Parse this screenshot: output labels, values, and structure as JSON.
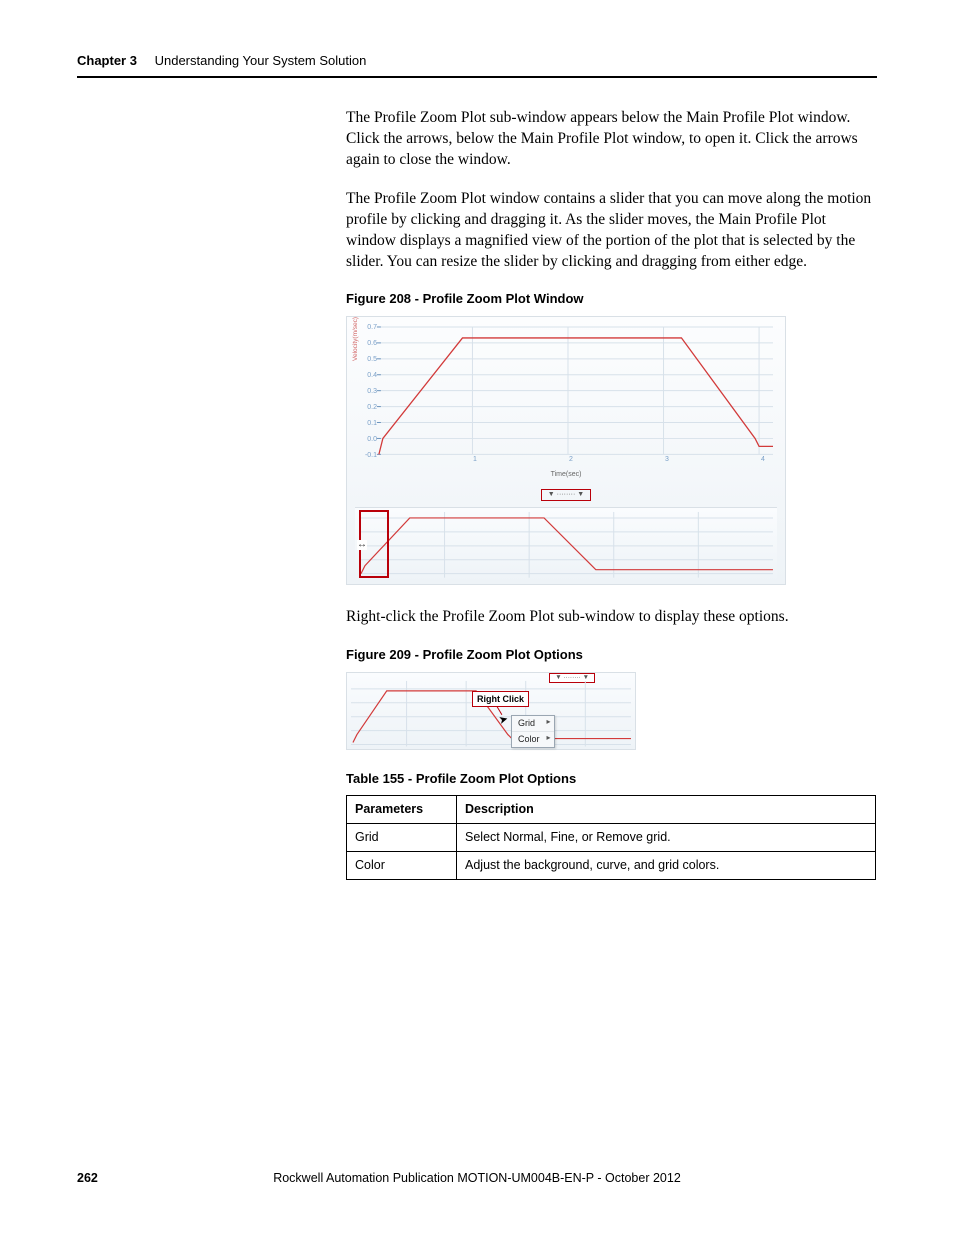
{
  "header": {
    "chapter": "Chapter 3",
    "title": "Understanding Your System Solution"
  },
  "paragraphs": {
    "p1": "The Profile Zoom Plot sub-window appears below the Main Profile Plot window. Click the arrows, below the Main Profile Plot window, to open it. Click the arrows again to close the window.",
    "p2": "The Profile Zoom Plot window contains a slider that you can move along the motion profile by clicking and dragging it. As the slider moves, the Main Profile Plot window displays a magnified view of the portion of the plot that is selected by the slider. You can resize the slider by clicking and dragging from either edge.",
    "p3": "Right-click the Profile Zoom Plot sub-window to display these options."
  },
  "figure208": {
    "caption": "Figure 208 - Profile Zoom Plot Window",
    "ylabel": "Velocity(m/sec)",
    "xlabel": "Time(sec)",
    "y_ticks": [
      "0.7",
      "0.6",
      "0.5",
      "0.4",
      "0.3",
      "0.2",
      "0.1",
      "0.0",
      "-0.1"
    ],
    "x_ticks": [
      "1",
      "2",
      "3",
      "4"
    ],
    "arrows_label": "▼ ········ ▼"
  },
  "figure209": {
    "caption": "Figure 209 - Profile Zoom Plot Options",
    "right_click_label": "Right Click",
    "arrows_label": "▼ ········ ▼",
    "menu": {
      "item1": "Grid",
      "item2": "Color"
    }
  },
  "table155": {
    "caption": "Table 155 - Profile Zoom Plot Options",
    "headers": {
      "c1": "Parameters",
      "c2": "Description"
    },
    "rows": [
      {
        "p": "Grid",
        "d": "Select Normal, Fine, or Remove grid."
      },
      {
        "p": "Color",
        "d": "Adjust the background, curve, and grid colors."
      }
    ]
  },
  "footer": {
    "page": "262",
    "pub": "Rockwell Automation Publication MOTION-UM004B-EN-P - October 2012"
  },
  "chart_data": {
    "type": "line",
    "title": "Profile Zoom Plot Window",
    "xlabel": "Time(sec)",
    "ylabel": "Velocity(m/sec)",
    "xlim": [
      0,
      4.3
    ],
    "ylim": [
      -0.1,
      0.7
    ],
    "series": [
      {
        "name": "Velocity",
        "x": [
          0,
          0.05,
          0.9,
          3.2,
          4.05,
          4.1,
          4.3
        ],
        "y": [
          -0.1,
          0.0,
          0.63,
          0.63,
          0.0,
          -0.05,
          -0.05
        ]
      }
    ]
  }
}
